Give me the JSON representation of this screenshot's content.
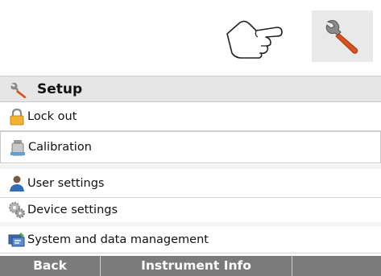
{
  "header": {
    "title": "Setup"
  },
  "menu": {
    "items": [
      {
        "label": "Lock out",
        "icon": "padlock-icon"
      },
      {
        "label": "Calibration",
        "icon": "weight-calibration-icon"
      },
      {
        "label": "User settings",
        "icon": "user-icon"
      },
      {
        "label": "Device settings",
        "icon": "gears-icon"
      },
      {
        "label": "System and data management",
        "icon": "system-data-icon"
      }
    ]
  },
  "bottom_bar": {
    "back_label": "Back",
    "info_label": "Instrument Info",
    "empty_label": ""
  },
  "colors": {
    "wrench_handle": "#d8531f",
    "wrench_head": "#8a8a8a",
    "bar": "#7b7b7b"
  }
}
